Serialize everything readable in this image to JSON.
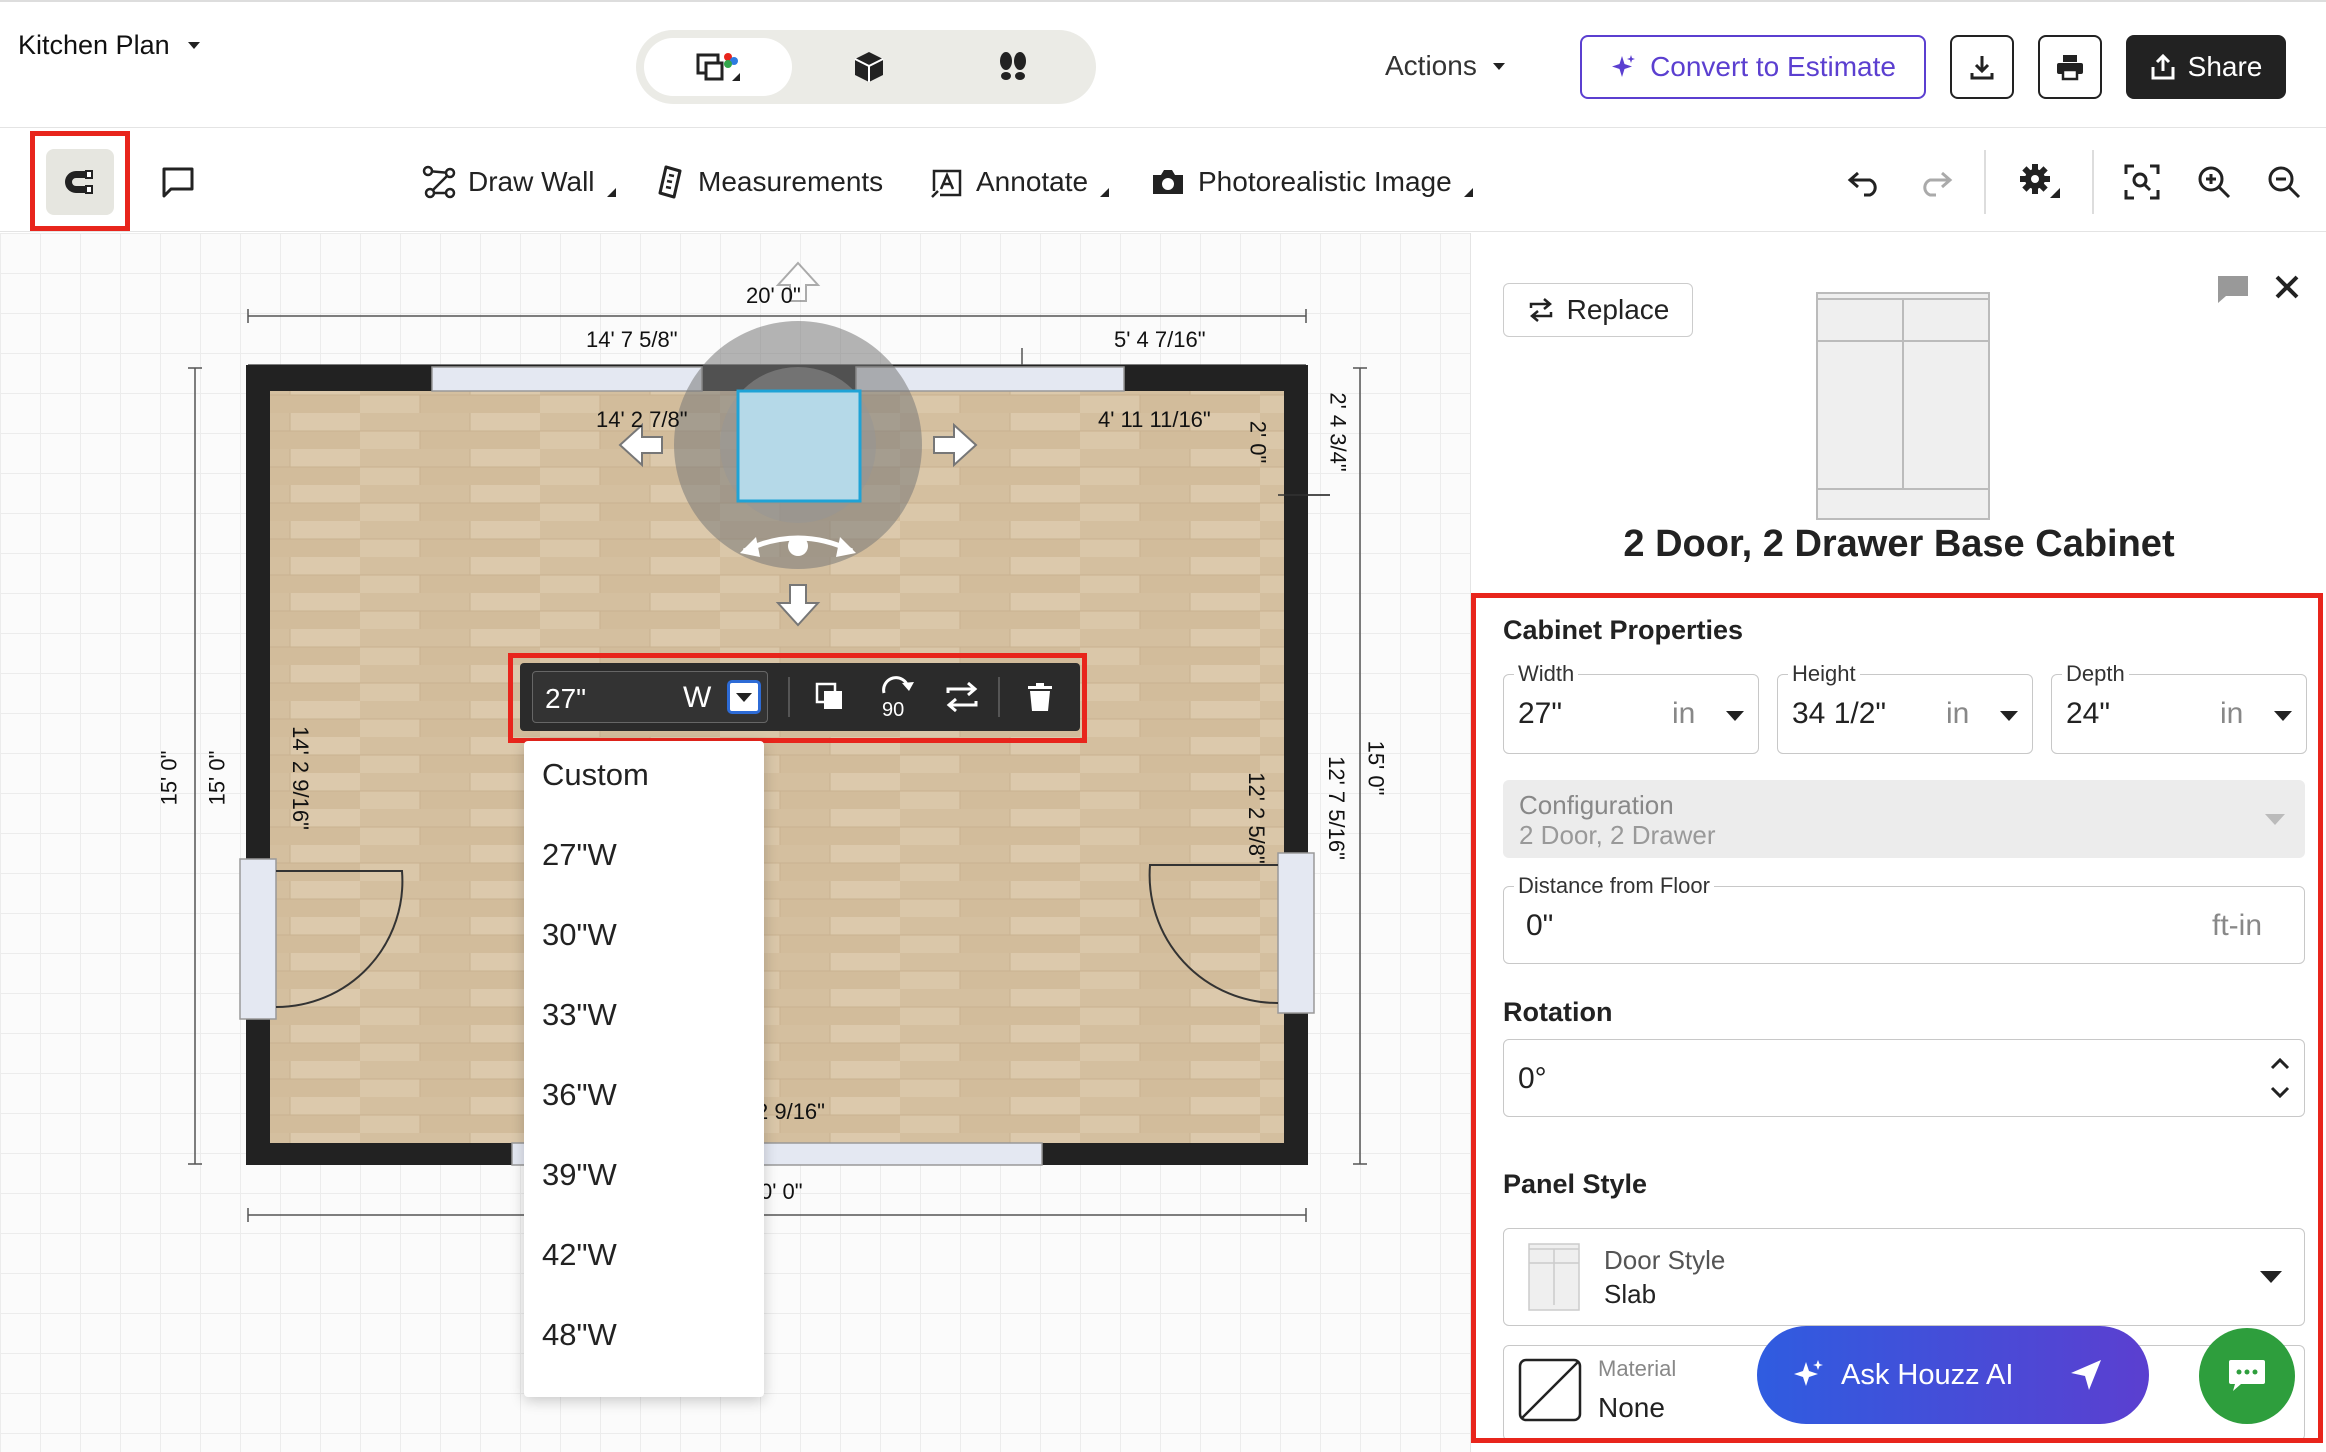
{
  "header": {
    "title": "Kitchen Plan",
    "actions_label": "Actions",
    "convert_label": "Convert to Estimate",
    "share_label": "Share",
    "view_toggle": [
      "2d-plan-icon",
      "3d-cube-icon",
      "walkthrough-footsteps-icon"
    ]
  },
  "toolbar": {
    "draw_wall": "Draw Wall",
    "measurements": "Measurements",
    "annotate": "Annotate",
    "photorealistic": "Photorealistic Image"
  },
  "plan": {
    "dimensions": {
      "top_total": "20' 0\"",
      "top_left": "14' 7 5/8\"",
      "top_right": "5' 4 7/16\"",
      "inner_left": "14' 2 7/8\"",
      "inner_right": "4' 11 11/16\"",
      "right_small_a": "2' 0\"",
      "right_small_b": "2' 4 3/4\"",
      "left_outer": "15' 0\"",
      "left_inner": "15' 0\"",
      "left_wall": "14' 2 9/16\"",
      "right_outer": "15' 0\"",
      "right_mid": "12' 7 5/16\"",
      "right_inner": "12' 2 5/8\"",
      "bottom_partial": "2 9/16\"",
      "bottom_total": "0' 0\""
    }
  },
  "float_toolbar": {
    "width_value": "27\"",
    "width_suffix": "W",
    "rotate_label": "90"
  },
  "width_dropdown": {
    "options": [
      "Custom",
      "27\"W",
      "30\"W",
      "33\"W",
      "36\"W",
      "39\"W",
      "42\"W",
      "48\"W"
    ]
  },
  "panel": {
    "replace_label": "Replace",
    "product_title": "2 Door, 2 Drawer Base Cabinet",
    "section_title": "Cabinet Properties",
    "width": {
      "label": "Width",
      "value": "27\"",
      "unit": "in"
    },
    "height": {
      "label": "Height",
      "value": "34 1/2\"",
      "unit": "in"
    },
    "depth": {
      "label": "Depth",
      "value": "24\"",
      "unit": "in"
    },
    "configuration": {
      "label": "Configuration",
      "value": "2 Door, 2 Drawer"
    },
    "distance": {
      "label": "Distance from Floor",
      "value": "0\"",
      "unit": "ft-in"
    },
    "rotation_title": "Rotation",
    "rotation_value": "0°",
    "panel_style_title": "Panel Style",
    "door_style": {
      "label": "Door Style",
      "value": "Slab"
    },
    "material": {
      "label": "Material",
      "value": "None"
    }
  },
  "assistant": {
    "ask_label": "Ask Houzz AI"
  },
  "colors": {
    "accent_purple": "#5b3fd0",
    "highlight_red": "#e8251c",
    "wall": "#222222",
    "selection_blue": "#1fa3d6",
    "chat_green": "#2e9e3d"
  }
}
